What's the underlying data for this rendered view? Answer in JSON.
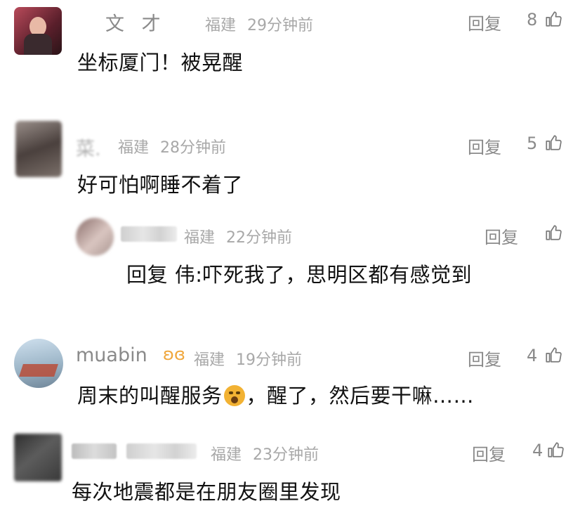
{
  "colors": {
    "meta": "#a8a8a8",
    "name": "#8a8a8a",
    "text": "#111111",
    "badge": "#f0a63a"
  },
  "comments": [
    {
      "name": "文 才",
      "location": "福建",
      "time": "29分钟前",
      "reply_label": "回复",
      "likes": "8",
      "text": "坐标厦门！被晃醒"
    },
    {
      "name": "菜.",
      "location": "福建",
      "time": "28分钟前",
      "reply_label": "回复",
      "likes": "5",
      "text": "好可怕啊睡不着了"
    },
    {
      "location": "福建",
      "time": "22分钟前",
      "reply_label": "回复",
      "text": "回复 伟:吓死我了，思明区都有感觉到"
    },
    {
      "name": "muabin",
      "location": "福建",
      "time": "19分钟前",
      "reply_label": "回复",
      "likes": "4",
      "text_before": "周末的叫醒服务",
      "text_after": "，醒了，然后要干嘛……"
    },
    {
      "location": "福建",
      "time": "23分钟前",
      "reply_label": "回复",
      "likes": "4",
      "text": "每次地震都是在朋友圈里发现"
    }
  ]
}
